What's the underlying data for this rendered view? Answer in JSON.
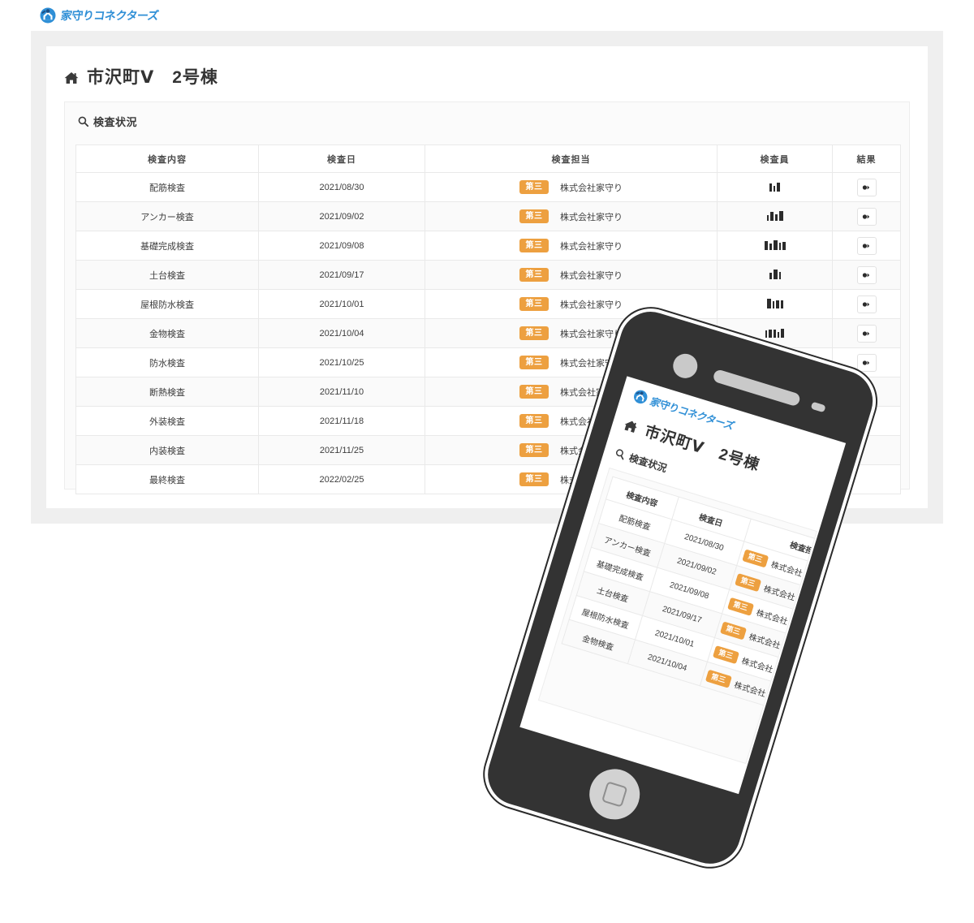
{
  "brand": {
    "name": "家守りコネクターズ",
    "logo_icon": "house-connector-logo-icon",
    "accent_color": "#2f8fd6"
  },
  "page": {
    "title": "市沢町Ⅴ　2号棟",
    "title_icon": "home-icon",
    "background_color": "#efefef"
  },
  "section": {
    "label": "検査状況",
    "icon": "search-icon"
  },
  "table": {
    "columns": [
      {
        "key": "content",
        "label": "検査内容"
      },
      {
        "key": "date",
        "label": "検査日"
      },
      {
        "key": "charge",
        "label": "検査担当"
      },
      {
        "key": "member",
        "label": "検査員"
      },
      {
        "key": "result",
        "label": "結果"
      }
    ],
    "badge_label": "第三",
    "badge_color": "#eda040",
    "company": "株式会社家守り",
    "result_icon": "result-report-icon",
    "rows": [
      {
        "content": "配筋検査",
        "date": "2021/08/30",
        "badge": "第三",
        "company": "株式会社家守り",
        "member": "",
        "has_result": true
      },
      {
        "content": "アンカー検査",
        "date": "2021/09/02",
        "badge": "第三",
        "company": "株式会社家守り",
        "member": "",
        "has_result": true
      },
      {
        "content": "基礎完成検査",
        "date": "2021/09/08",
        "badge": "第三",
        "company": "株式会社家守り",
        "member": "",
        "has_result": true
      },
      {
        "content": "土台検査",
        "date": "2021/09/17",
        "badge": "第三",
        "company": "株式会社家守り",
        "member": "",
        "has_result": true
      },
      {
        "content": "屋根防水検査",
        "date": "2021/10/01",
        "badge": "第三",
        "company": "株式会社家守り",
        "member": "",
        "has_result": true
      },
      {
        "content": "金物検査",
        "date": "2021/10/04",
        "badge": "第三",
        "company": "株式会社家守り",
        "member": "",
        "has_result": true
      },
      {
        "content": "防水検査",
        "date": "2021/10/25",
        "badge": "第三",
        "company": "株式会社家守り",
        "member": "",
        "has_result": true
      },
      {
        "content": "断熱検査",
        "date": "2021/11/10",
        "badge": "第三",
        "company": "株式会社家守り",
        "member": "",
        "has_result": false
      },
      {
        "content": "外装検査",
        "date": "2021/11/18",
        "badge": "第三",
        "company": "株式会社家守り",
        "member": "",
        "has_result": false
      },
      {
        "content": "内装検査",
        "date": "2021/11/25",
        "badge": "第三",
        "company": "株式会社家守り",
        "member": "",
        "has_result": false
      },
      {
        "content": "最終検査",
        "date": "2022/02/25",
        "badge": "第三",
        "company": "株式会社家守り",
        "member": "",
        "has_result": false
      }
    ]
  },
  "phone": {
    "camera_icon": "front-camera-icon",
    "speaker_icon": "earpiece-speaker-icon",
    "sensor_icon": "proximity-sensor-icon",
    "home_button_icon": "home-button-icon",
    "screen": {
      "brand_name": "家守りコネクターズ",
      "title": "市沢町Ⅴ　2号棟",
      "section_label": "検査状況",
      "columns": [
        {
          "key": "content",
          "label": "検査内容"
        },
        {
          "key": "date",
          "label": "検査日"
        },
        {
          "key": "charge",
          "label": "検査担当"
        }
      ],
      "rows": [
        {
          "content": "配筋検査",
          "date": "2021/08/30",
          "badge": "第三",
          "company": "株式会社"
        },
        {
          "content": "アンカー検査",
          "date": "2021/09/02",
          "badge": "第三",
          "company": "株式会社"
        },
        {
          "content": "基礎完成検査",
          "date": "2021/09/08",
          "badge": "第三",
          "company": "株式会社"
        },
        {
          "content": "土台検査",
          "date": "2021/09/17",
          "badge": "第三",
          "company": "株式会社"
        },
        {
          "content": "屋根防水検査",
          "date": "2021/10/01",
          "badge": "第三",
          "company": "株式会社"
        },
        {
          "content": "金物検査",
          "date": "2021/10/04",
          "badge": "第三",
          "company": "株式会社"
        }
      ]
    }
  }
}
